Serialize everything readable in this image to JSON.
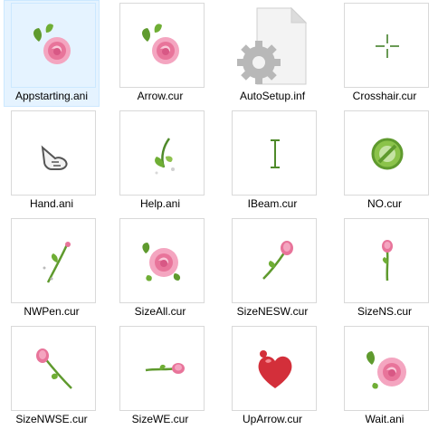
{
  "files": [
    {
      "name": "Appstarting.ani",
      "icon": "rose-icon",
      "selected": true
    },
    {
      "name": "Arrow.cur",
      "icon": "rose-icon"
    },
    {
      "name": "AutoSetup.inf",
      "icon": "settings-file-icon"
    },
    {
      "name": "Crosshair.cur",
      "icon": "crosshair-icon"
    },
    {
      "name": "Hand.ani",
      "icon": "hand-pointer-icon"
    },
    {
      "name": "Help.ani",
      "icon": "leaf-sprout-icon"
    },
    {
      "name": "IBeam.cur",
      "icon": "ibeam-icon"
    },
    {
      "name": "NO.cur",
      "icon": "no-sign-icon"
    },
    {
      "name": "NWPen.cur",
      "icon": "rose-stem-pen-icon"
    },
    {
      "name": "SizeAll.cur",
      "icon": "rose-icon"
    },
    {
      "name": "SizeNESW.cur",
      "icon": "rose-diagonal-icon"
    },
    {
      "name": "SizeNS.cur",
      "icon": "rose-vertical-icon"
    },
    {
      "name": "SizeNWSE.cur",
      "icon": "rose-diagonal-nwse-icon"
    },
    {
      "name": "SizeWE.cur",
      "icon": "rose-horizontal-icon"
    },
    {
      "name": "UpArrow.cur",
      "icon": "heart-icon"
    },
    {
      "name": "Wait.ani",
      "icon": "rose-icon"
    }
  ],
  "colors": {
    "selection_bg": "#e5f3ff",
    "selection_border": "#cce8ff",
    "thumb_border": "#d9d9d9",
    "rose_pink": "#e8749a",
    "leaf_green": "#5f9a2e"
  }
}
